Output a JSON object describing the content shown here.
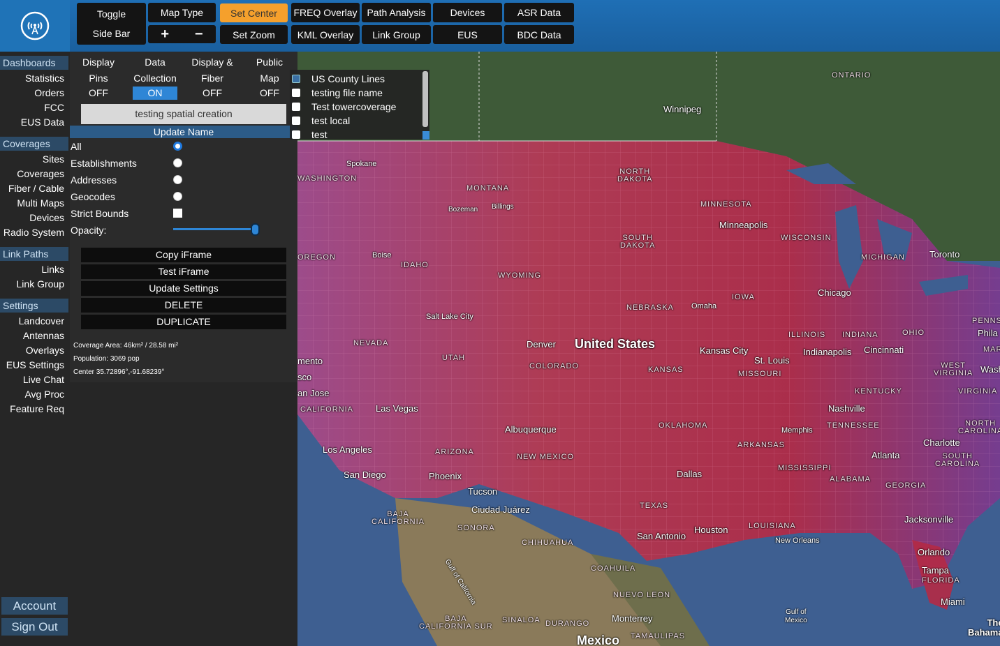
{
  "toolbar": {
    "toggle_sidebar": [
      "Toggle",
      "Side Bar"
    ],
    "map_type": "Map Type",
    "zoom_in": "+",
    "zoom_out": "−",
    "set_center": "Set Center",
    "set_zoom": "Set Zoom",
    "freq_overlay": "FREQ Overlay",
    "kml_overlay": "KML Overlay",
    "path_analysis": "Path Analysis",
    "link_group": "Link Group",
    "devices": "Devices",
    "eus": "EUS",
    "asr_data": "ASR Data",
    "bdc_data": "BDC Data",
    "active_color": "#f5a02c"
  },
  "sidebar": {
    "dashboards": {
      "title": "Dashboards",
      "items": [
        "Statistics",
        "Orders",
        "FCC",
        "EUS Data"
      ]
    },
    "coverages": {
      "title": "Coverages",
      "items": [
        "Sites",
        "Coverages",
        "Fiber / Cable",
        "Multi Maps",
        "Devices",
        "Radio System"
      ]
    },
    "link_paths": {
      "title": "Link Paths",
      "items": [
        "Links",
        "Link Group"
      ]
    },
    "settings": {
      "title": "Settings",
      "items": [
        "Landcover",
        "Antennas",
        "Overlays",
        "EUS Settings",
        "Live Chat",
        "Avg Proc",
        "Feature Req"
      ]
    },
    "account": "Account",
    "sign_out": "Sign Out"
  },
  "panel": {
    "toggles": [
      {
        "label1": "Display",
        "label2": "Pins",
        "state": "OFF"
      },
      {
        "label1": "Data",
        "label2": "Collection",
        "state": "ON"
      },
      {
        "label1": "Display &",
        "label2": "Fiber",
        "state": "OFF"
      },
      {
        "label1": "Public",
        "label2": "Map",
        "state": "OFF"
      }
    ],
    "name_value": "testing spatial creation",
    "update_name": "Update Name",
    "options": [
      "All",
      "Establishments",
      "Addresses",
      "Geocodes",
      "Strict Bounds",
      "Opacity:"
    ],
    "actions": [
      "Copy iFrame",
      "Test iFrame",
      "Update Settings",
      "DELETE",
      "DUPLICATE"
    ],
    "info": {
      "coverage_area": "Coverage Area: 46km² / 28.58 mi²",
      "population": "Population: 3069 pop",
      "center": "Center 35.72896°,-91.68239°"
    },
    "opacity": 1.0
  },
  "layers": [
    "US County Lines",
    "testing file name",
    "Test towercoverage",
    "test local",
    "test"
  ],
  "map": {
    "labels": {
      "ontario": "ONTARIO",
      "winnipeg": "Winnipeg",
      "washington": "WASHINGTON",
      "spokane": "Spokane",
      "north_dakota": "NORTH\nDAKOTA",
      "montana": "MONTANA",
      "bozeman": "Bozeman",
      "billings": "Billings",
      "minnesota": "MINNESOTA",
      "minneapolis": "Minneapolis",
      "wisconsin": "WISCONSIN",
      "michigan": "MICHIGAN",
      "toronto": "Toronto",
      "south_dakota": "SOUTH\nDAKOTA",
      "oregon": "OREGON",
      "boise": "Boise",
      "idaho": "IDAHO",
      "wyoming": "WYOMING",
      "iowa": "IOWA",
      "chicago": "Chicago",
      "nebraska": "NEBRASKA",
      "omaha": "Omaha",
      "salt_lake_city": "Salt Lake City",
      "pennsylvania": "PENNSYLV",
      "phila": "Phila",
      "nevada": "NEVADA",
      "utah": "UTAH",
      "denver": "Denver",
      "united_states": "United States",
      "illinois": "ILLINOIS",
      "indiana": "INDIANA",
      "ohio": "OHIO",
      "mar": "MAR",
      "sacramento": "mento",
      "sco": "sco",
      "colorado": "COLORADO",
      "kansas": "KANSAS",
      "kansas_city": "Kansas City",
      "st_louis": "St. Louis",
      "missouri": "MISSOURI",
      "indianapolis": "Indianapolis",
      "cincinnati": "Cincinnati",
      "west_virginia": "WEST\nVIRGINIA",
      "wash": "Wash",
      "san_jose": "an Jose",
      "kentucky": "KENTUCKY",
      "virginia": "VIRGINIA",
      "california": "CALIFORNIA",
      "las_vegas": "Las Vegas",
      "nashville": "Nashville",
      "tennessee": "TENNESSEE",
      "north_carolina": "NORTH\nCAROLINA",
      "albuquerque": "Albuquerque",
      "oklahoma": "OKLAHOMA",
      "memphis": "Memphis",
      "charlotte": "Charlotte",
      "los_angeles": "Los Angeles",
      "arizona": "ARIZONA",
      "new_mexico": "NEW MEXICO",
      "arkansas": "ARKANSAS",
      "atlanta": "Atlanta",
      "south_carolina": "SOUTH\nCAROLINA",
      "san_diego": "San Diego",
      "phoenix": "Phoenix",
      "mississippi": "MISSISSIPPI",
      "dallas": "Dallas",
      "alabama": "ALABAMA",
      "georgia": "GEORGIA",
      "tucson": "Tucson",
      "baja_california": "BAJA\nCALIFORNIA",
      "ciudad_juarez": "Ciudad Juárez",
      "texas": "TEXAS",
      "sonora": "SONORA",
      "louisiana": "LOUISIANA",
      "jacksonville": "Jacksonville",
      "houston": "Houston",
      "san_antonio": "San Antonio",
      "new_orleans": "New Orleans",
      "chihuahua": "CHIHUAHUA",
      "orlando": "Orlando",
      "gulf_of_california": "Gulf of California",
      "coahuila": "COAHUILA",
      "tampa": "Tampa",
      "florida": "FLORIDA",
      "nuevo_leon": "NUEVO LEON",
      "miami": "Miami",
      "gulf_of_mexico": "Gulf of\nMexico",
      "baja_california_sur": "BAJA\nCALIFORNIA SUR",
      "sinaloa": "SINALOA",
      "durango": "DURANGO",
      "monterrey": "Monterrey",
      "tamaulipas": "TAMAULIPAS",
      "mexico": "Mexico",
      "the_bahamas": "The\nBahama"
    }
  }
}
